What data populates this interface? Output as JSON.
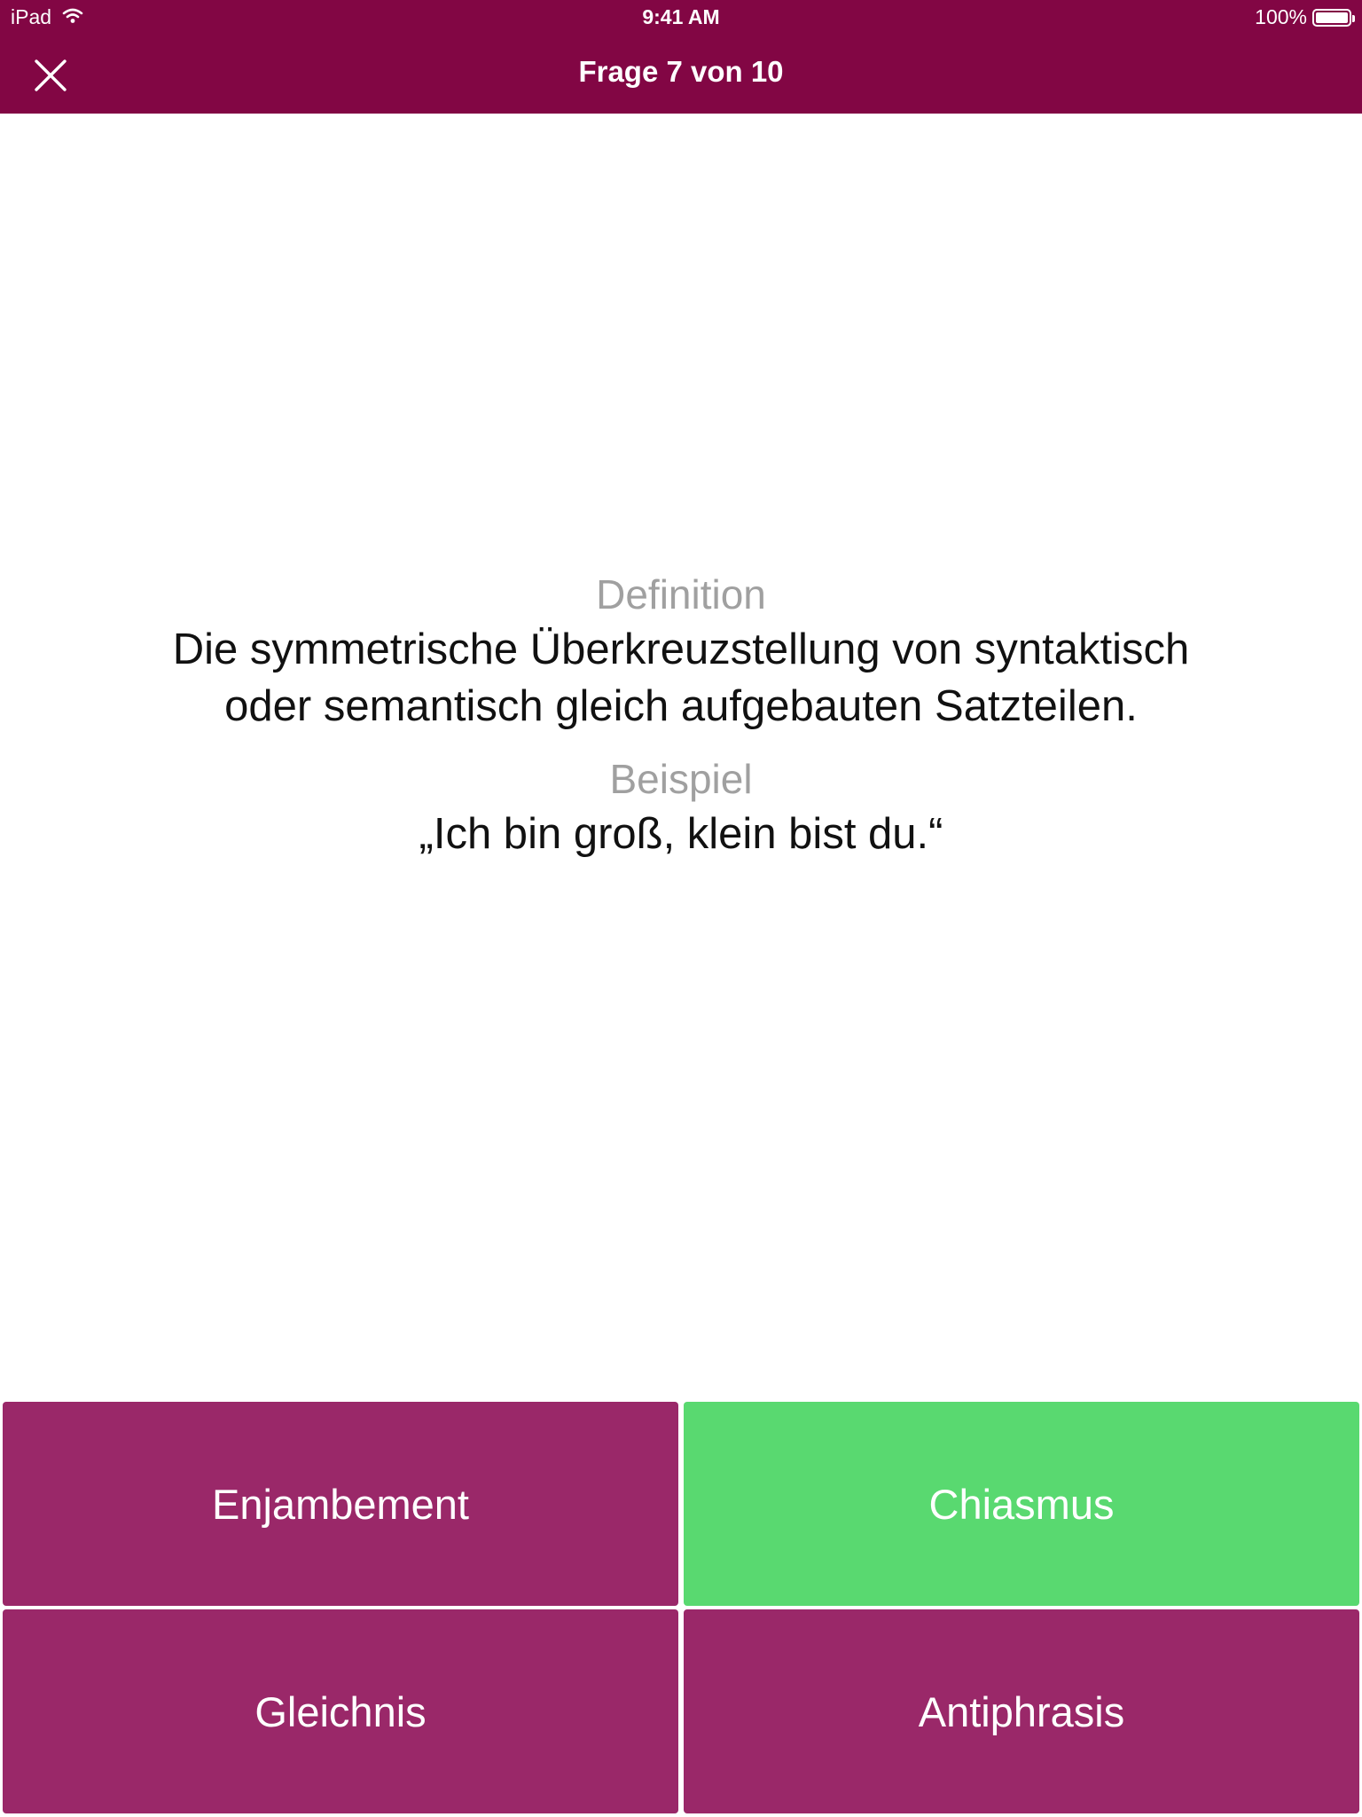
{
  "status_bar": {
    "device": "iPad",
    "time": "9:41 AM",
    "battery": "100%",
    "battery_level": 1.0
  },
  "nav": {
    "title": "Frage 7 von 10",
    "close_icon": "close-icon"
  },
  "question": {
    "definition_label": "Definition",
    "definition_text": "Die symmetrische Überkreuzstellung von syntaktisch oder semantisch gleich aufgebauten Satzteilen.",
    "example_label": "Beispiel",
    "example_text": "„Ich bin groß, klein bist du.“"
  },
  "answers": [
    {
      "label": "Enjambement",
      "state": "default"
    },
    {
      "label": "Chiasmus",
      "state": "correct"
    },
    {
      "label": "Gleichnis",
      "state": "default"
    },
    {
      "label": "Antiphrasis",
      "state": "default"
    }
  ],
  "colors": {
    "header": "#820644",
    "answer_default": "#9a2869",
    "answer_correct": "#59d970",
    "label_gray": "#a0a0a0"
  }
}
